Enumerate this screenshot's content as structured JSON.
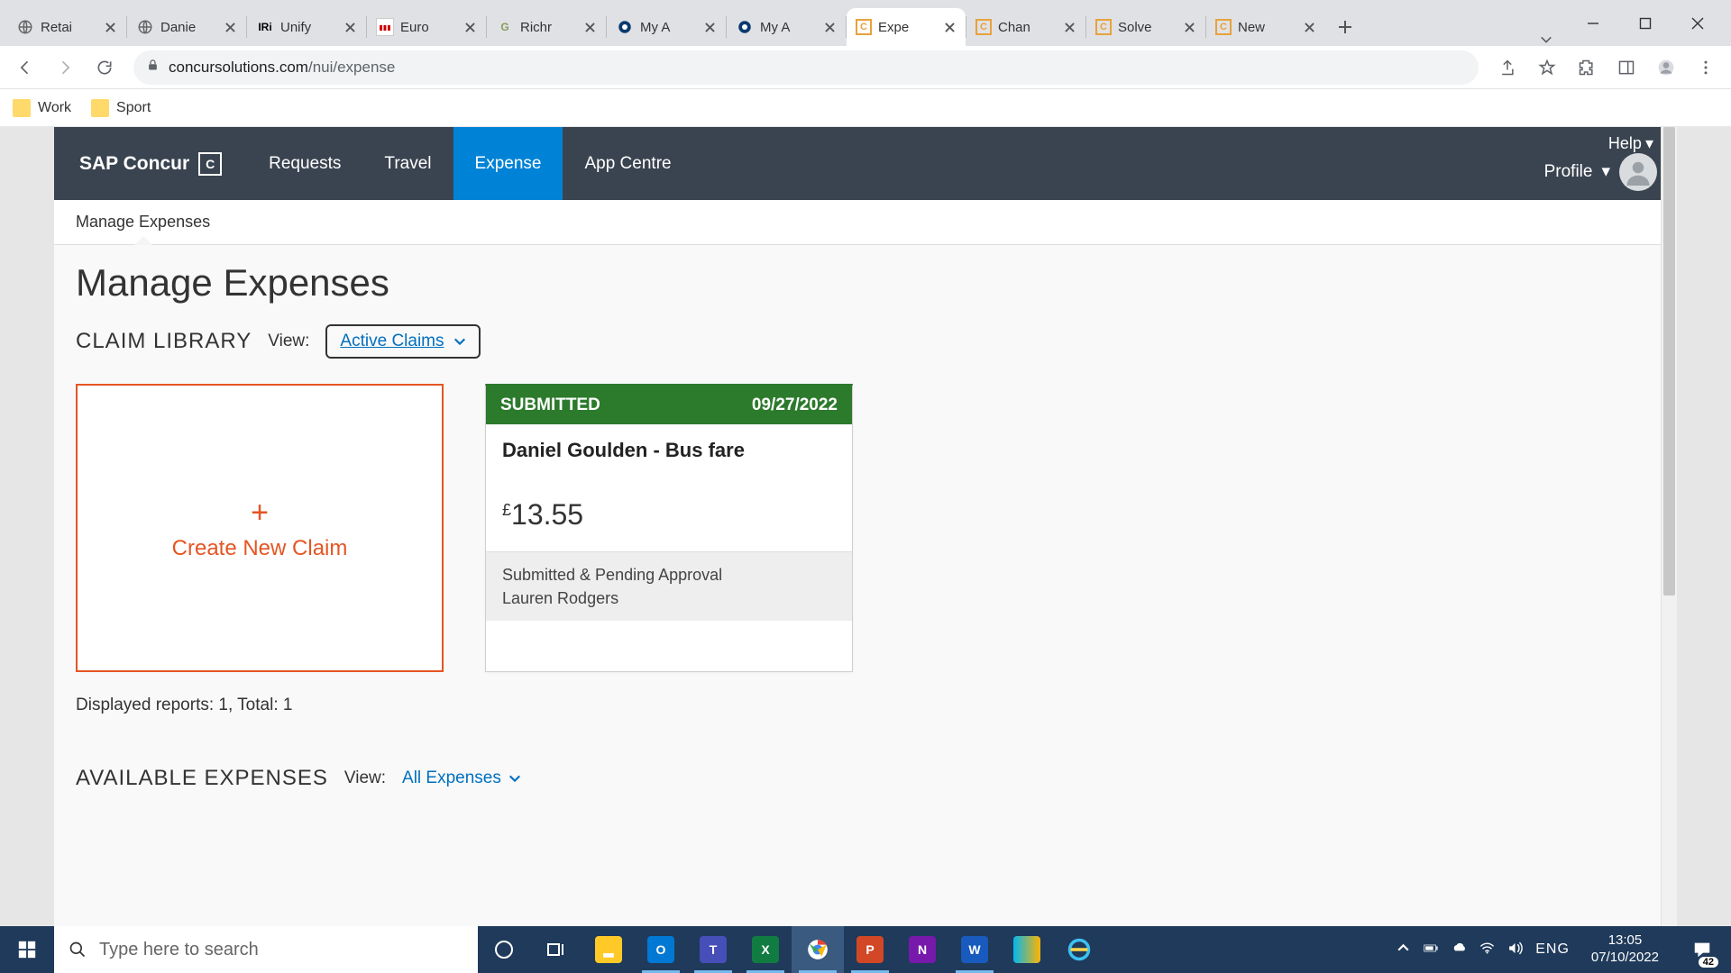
{
  "browser": {
    "tabs": [
      {
        "label": "Retai"
      },
      {
        "label": "Danie"
      },
      {
        "label": "Unify"
      },
      {
        "label": "Euro"
      },
      {
        "label": "Richr"
      },
      {
        "label": "My A"
      },
      {
        "label": "My A"
      },
      {
        "label": "Expe"
      },
      {
        "label": "Chan"
      },
      {
        "label": "Solve"
      },
      {
        "label": "New"
      }
    ],
    "active_tab_index": 7,
    "url_host": "concursolutions.com",
    "url_path": "/nui/expense",
    "bookmarks": [
      {
        "label": "Work"
      },
      {
        "label": "Sport"
      }
    ]
  },
  "concur": {
    "logo": "SAP Concur",
    "nav": {
      "requests": "Requests",
      "travel": "Travel",
      "expense": "Expense",
      "appcentre": "App Centre"
    },
    "help": "Help",
    "profile": "Profile",
    "subnav": "Manage Expenses",
    "page_title": "Manage Expenses",
    "claim_library": {
      "label": "CLAIM LIBRARY",
      "view_label": "View:",
      "view_select": "Active Claims",
      "create_label": "Create New Claim",
      "claim": {
        "status": "SUBMITTED",
        "date": "09/27/2022",
        "title": "Daniel Goulden - Bus fare",
        "currency": "£",
        "amount": "13.55",
        "footer_line1": "Submitted & Pending Approval",
        "footer_line2": "Lauren Rodgers"
      },
      "counts": "Displayed reports: 1, Total: 1"
    },
    "available": {
      "label": "AVAILABLE EXPENSES",
      "view_label": "View:",
      "view_select": "All Expenses"
    }
  },
  "taskbar": {
    "search_placeholder": "Type here to search",
    "lang": "ENG",
    "time": "13:05",
    "date": "07/10/2022",
    "notif_count": "42"
  }
}
